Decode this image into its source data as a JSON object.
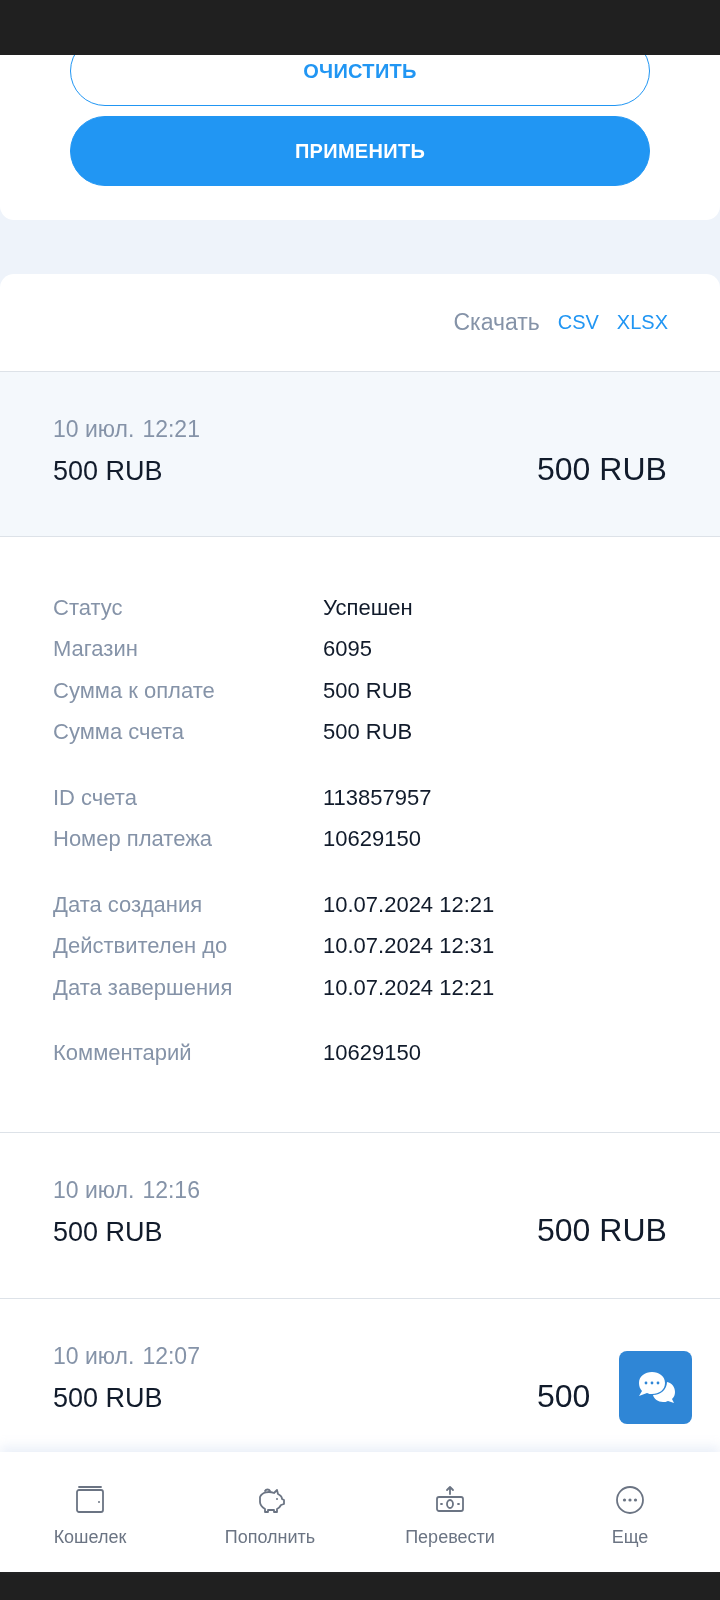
{
  "filter_actions": [
    {
      "label": "ОЧИСТИТЬ",
      "kind": "outline"
    },
    {
      "label": "ПРИМЕНИТЬ",
      "kind": "filled"
    }
  ],
  "download": {
    "label": "Скачать",
    "formats": [
      "CSV",
      "XLSX"
    ]
  },
  "transactions": [
    {
      "date": "10 июл.",
      "time": "12:21",
      "amount": "500 RUB",
      "total": "500 RUB",
      "expanded": true,
      "details": [
        [
          {
            "label": "Статус",
            "value": "Успешен"
          },
          {
            "label": "Магазин",
            "value": "6095"
          },
          {
            "label": "Сумма к оплате",
            "value": "500 RUB"
          },
          {
            "label": "Сумма счета",
            "value": "500 RUB"
          }
        ],
        [
          {
            "label": "ID счета",
            "value": "113857957"
          },
          {
            "label": "Номер платежа",
            "value": "10629150"
          }
        ],
        [
          {
            "label": "Дата создания",
            "value": "10.07.2024 12:21"
          },
          {
            "label": "Действителен до",
            "value": "10.07.2024 12:31"
          },
          {
            "label": "Дата завершения",
            "value": "10.07.2024 12:21"
          }
        ],
        [
          {
            "label": "Комментарий",
            "value": "10629150"
          }
        ]
      ]
    },
    {
      "date": "10 июл.",
      "time": "12:16",
      "amount": "500 RUB",
      "total": "500 RUB",
      "expanded": false
    },
    {
      "date": "10 июл.",
      "time": "12:07",
      "amount": "500 RUB",
      "total": "500",
      "expanded": false
    }
  ],
  "nav": [
    {
      "label": "Кошелек",
      "kind": "wallet"
    },
    {
      "label": "Пополнить",
      "kind": "piggy"
    },
    {
      "label": "Перевести",
      "kind": "transfer"
    },
    {
      "label": "Еще",
      "kind": "more"
    }
  ]
}
